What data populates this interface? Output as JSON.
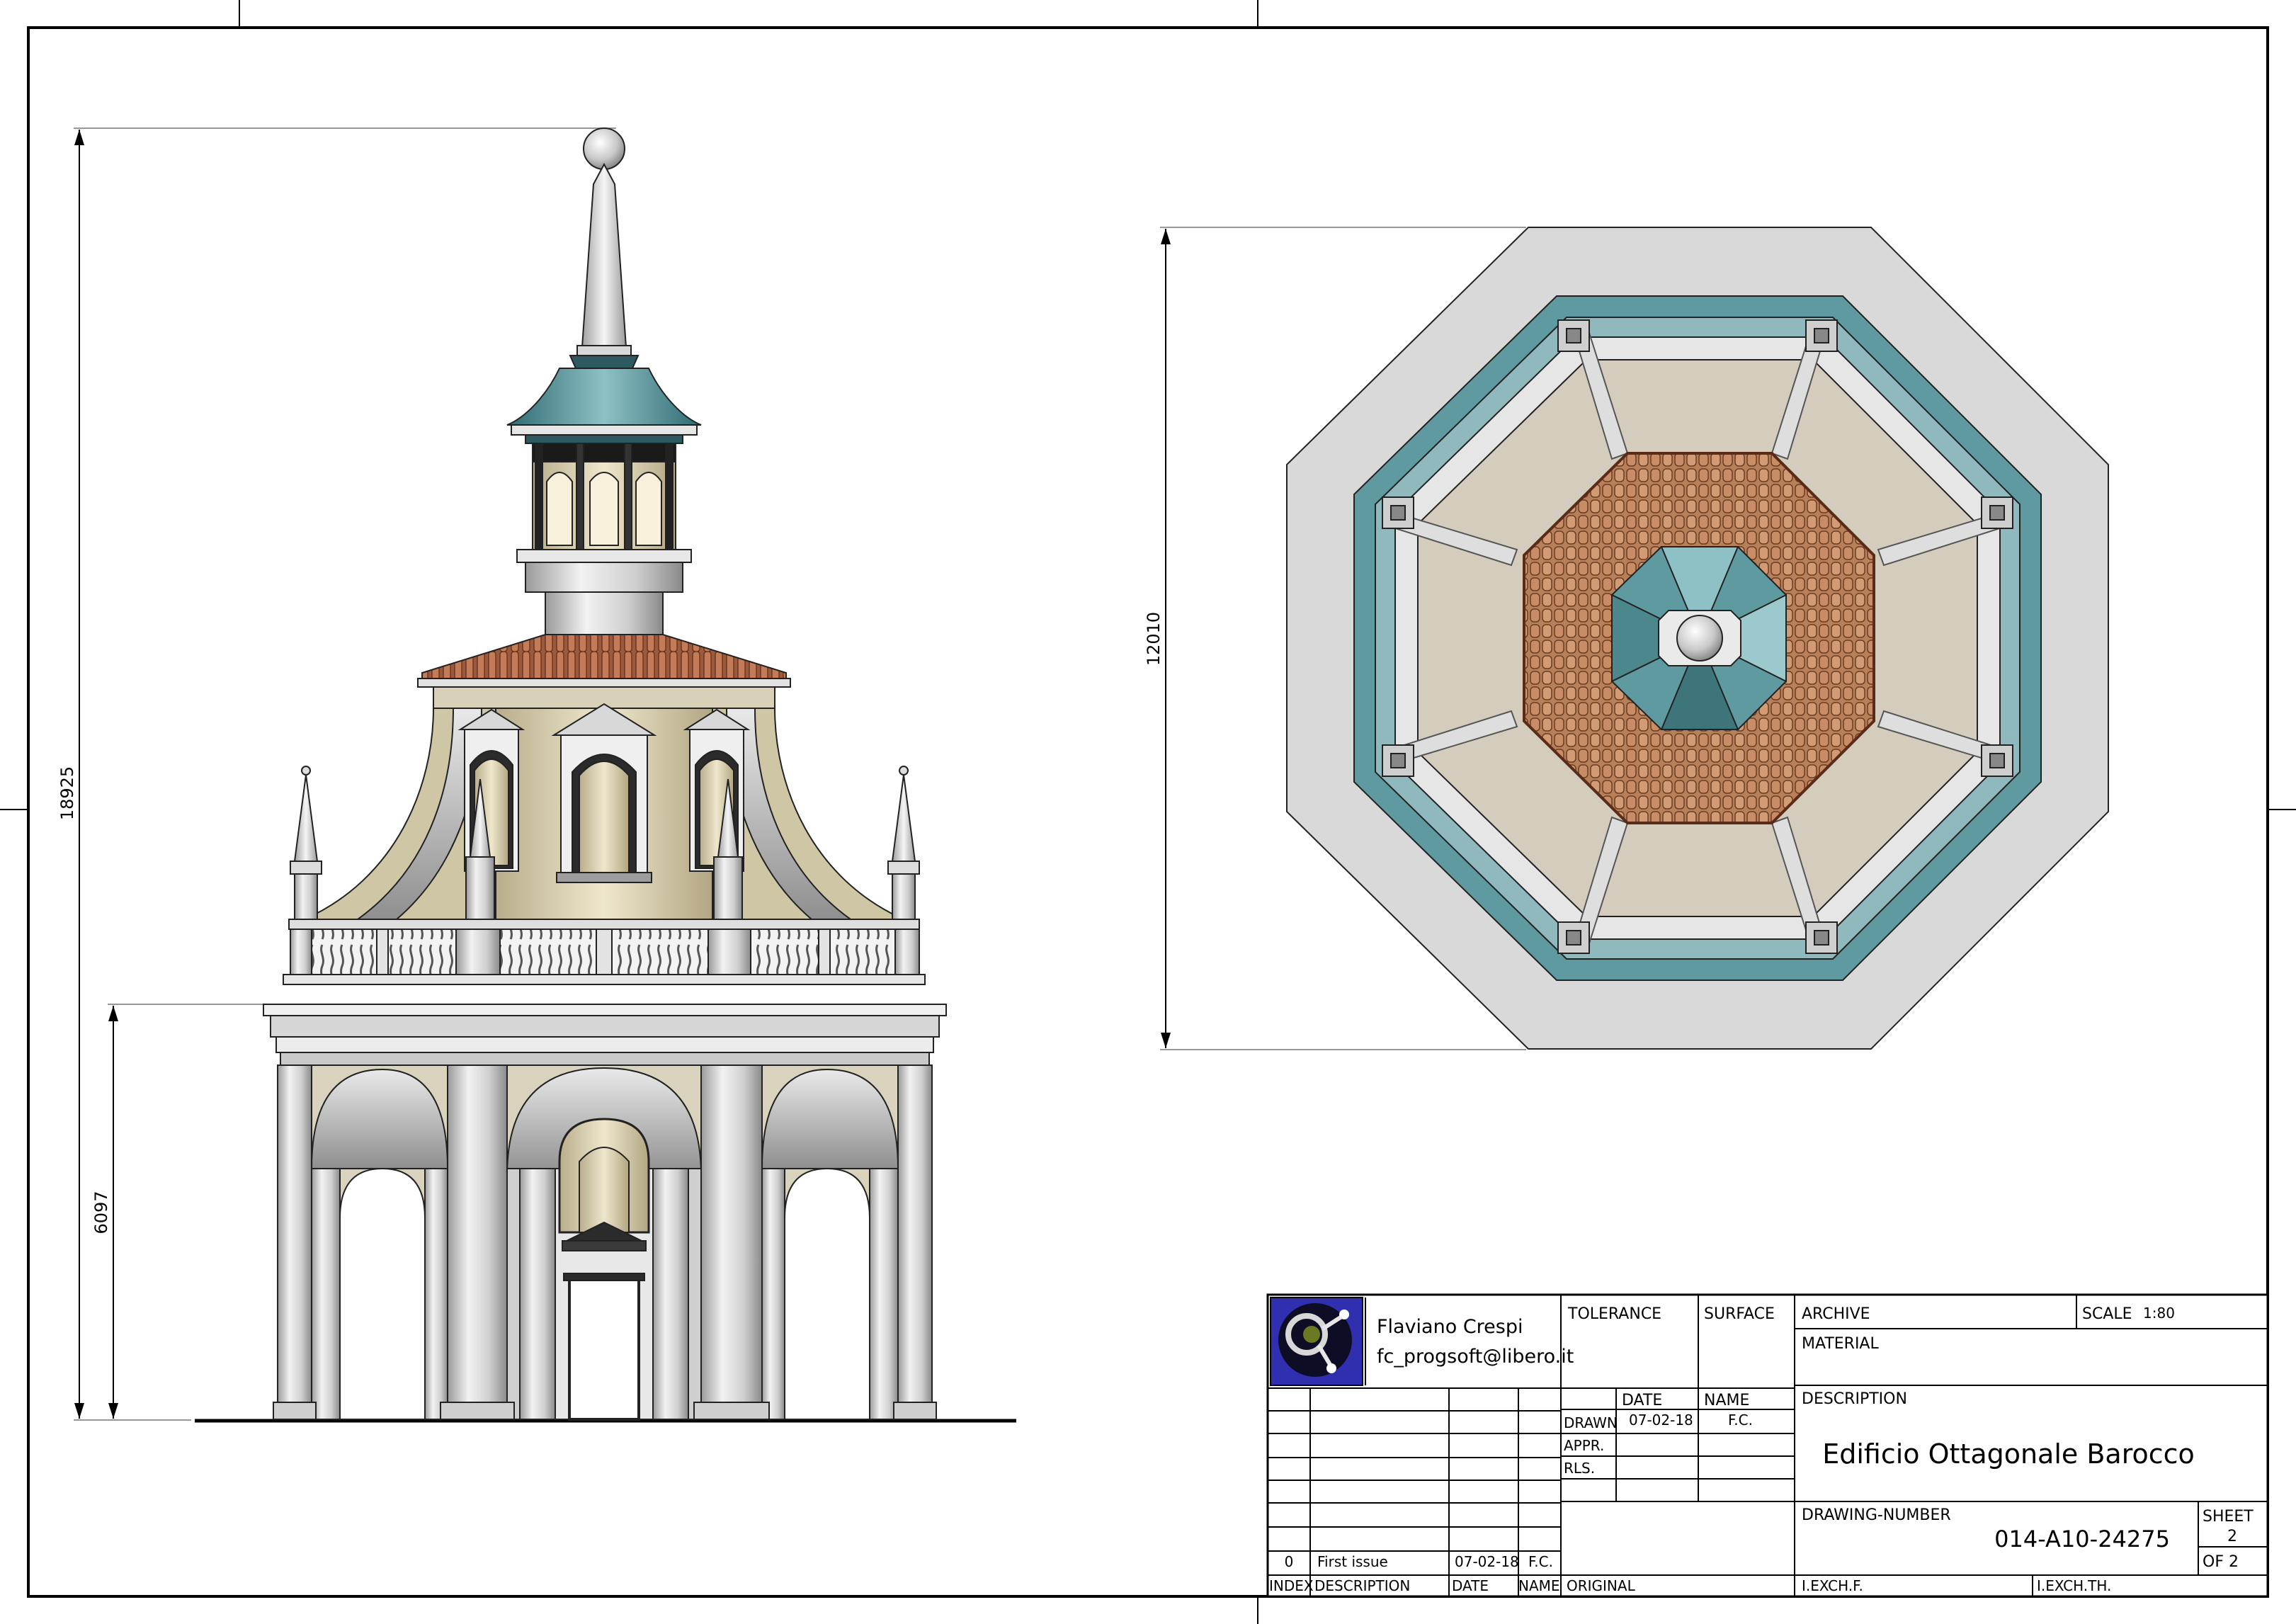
{
  "dimensions": {
    "total_height": "18925",
    "ground_height": "6097",
    "plan_width": "12010"
  },
  "title_block": {
    "author_name": "Flaviano Crespi",
    "author_email": "fc_progsoft@libero.it",
    "logo_icon": "cf-monogram-logo",
    "labels": {
      "tolerance": "TOLERANCE",
      "surface": "SURFACE",
      "archive": "ARCHIVE",
      "scale": "SCALE",
      "material": "MATERIAL",
      "date": "DATE",
      "name": "NAME",
      "drawn": "DRAWN",
      "appr": "APPR.",
      "rls": "RLS.",
      "description": "DESCRIPTION",
      "drawing_number": "DRAWING-NUMBER",
      "sheet": "SHEET",
      "index": "INDEX",
      "rev_description": "DESCRIPTION",
      "rev_date": "DATE",
      "rev_name": "NAME",
      "original": "ORIGINAL",
      "iexch_f": "I.EXCH.F.",
      "iexch_th": "I.EXCH.TH."
    },
    "scale_value": "1:80",
    "drawn_date": "07-02-18",
    "drawn_name": "F.C.",
    "description_value": "Edificio Ottagonale Barocco",
    "drawing_number_value": "014-A10-24275",
    "sheet_number": "2",
    "sheet_of": "OF 2",
    "revision": {
      "index": "0",
      "description": "First issue",
      "date": "07-02-18",
      "name": "F.C."
    }
  },
  "colors": {
    "teal_roof": "#4f8c93",
    "tile_brown": "#b37b55",
    "cream_wall": "#e3dcc3",
    "beige_panel": "#d6cfbf",
    "light_gray": "#dcdcdc",
    "stone": "#bdbdbd",
    "logo_blue": "#2f2fb0"
  }
}
